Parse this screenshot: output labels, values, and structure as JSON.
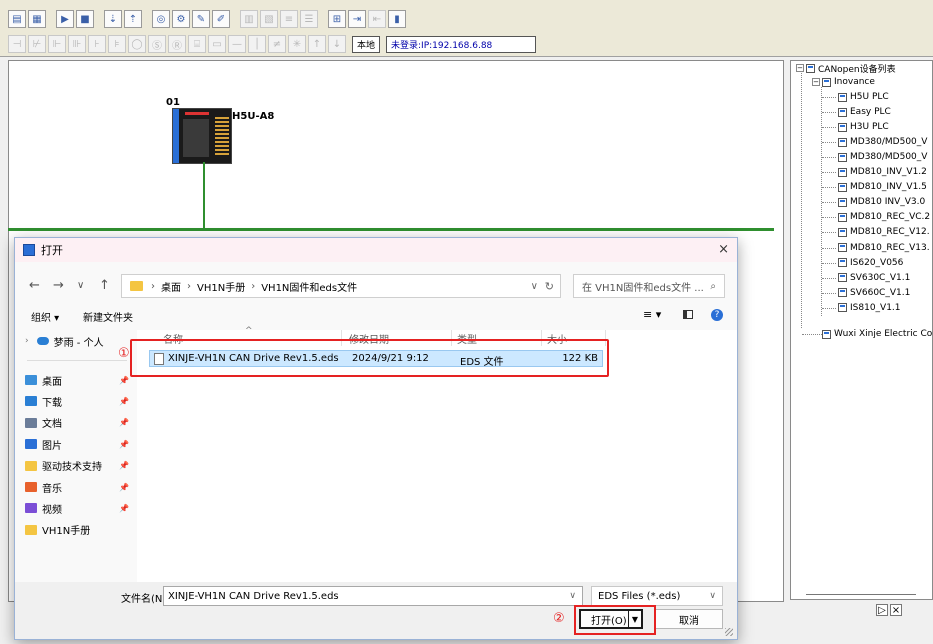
{
  "canvas": {
    "device_number": "01",
    "device_name": "H5U-A8",
    "bus_color": "#2f8f2f"
  },
  "toolbar": {
    "local_label": "本地",
    "login_status": "未登录:IP:192.168.6.88"
  },
  "tree": {
    "root": "CANopen设备列表",
    "vendor": "Inovance",
    "items": [
      "H5U PLC",
      "Easy PLC",
      "H3U PLC",
      "MD380/MD500_V",
      "MD380/MD500_V",
      "MD810_INV_V1.2",
      "MD810_INV_V1.5",
      "MD810 INV_V3.0",
      "MD810_REC_VC.2",
      "MD810_REC_V12.",
      "MD810_REC_V13.",
      "IS620_V056",
      "SV630C_V1.1",
      "SV660C_V1.1",
      "IS810_V1.1"
    ],
    "vendor2": "Wuxi Xinje Electric Co",
    "window_controls": [
      "▷",
      "×"
    ]
  },
  "dialog": {
    "title": "打开",
    "close": "×",
    "breadcrumb": [
      "桌面",
      "VH1N手册",
      "VH1N固件和eds文件"
    ],
    "search_placeholder": "在 VH1N固件和eds文件 ...",
    "organize": "组织 ▾",
    "new_folder": "新建文件夹",
    "nav": {
      "top": "梦雨 - 个人",
      "items": [
        {
          "label": "桌面",
          "color": "#3b8fd9",
          "pinned": true
        },
        {
          "label": "下载",
          "color": "#2a7fd4",
          "pinned": true
        },
        {
          "label": "文档",
          "color": "#6b7d99",
          "pinned": true
        },
        {
          "label": "图片",
          "color": "#2a6fd6",
          "pinned": true
        },
        {
          "label": "驱动技术支持",
          "color": "#f4c542",
          "pinned": true
        },
        {
          "label": "音乐",
          "color": "#e8612c",
          "pinned": true
        },
        {
          "label": "视频",
          "color": "#7b4ed6",
          "pinned": true
        },
        {
          "label": "VH1N手册",
          "color": "#f4c542",
          "pinned": false
        }
      ]
    },
    "columns": [
      "名称",
      "修改日期",
      "类型",
      "大小"
    ],
    "files": [
      {
        "name": "XINJE-VH1N CAN Drive Rev1.5.eds",
        "date": "2024/9/21 9:12",
        "type": "EDS 文件",
        "size": "122 KB"
      }
    ],
    "filename_label": "文件名(N):",
    "filename_value": "XINJE-VH1N CAN Drive Rev1.5.eds",
    "filetype": "EDS Files (*.eds)",
    "open_button": "打开(O)",
    "cancel_button": "取消",
    "markers": [
      "①",
      "②"
    ]
  }
}
